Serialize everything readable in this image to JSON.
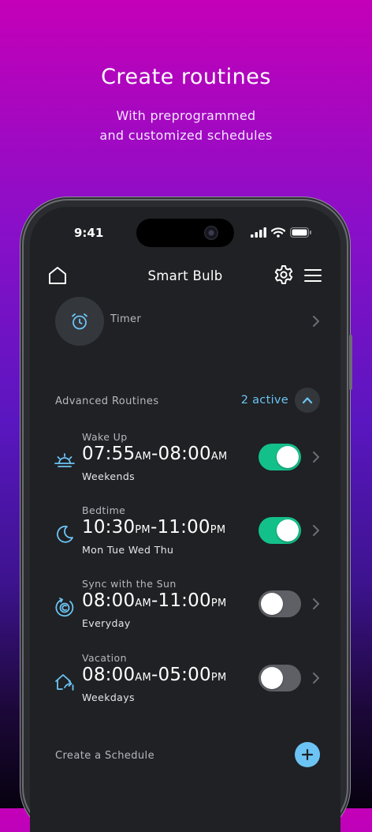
{
  "promo": {
    "headline": "Create routines",
    "sub_line1": "With preprogrammed",
    "sub_line2": "and customized schedules"
  },
  "status_bar": {
    "time": "9:41"
  },
  "header": {
    "title": "Smart Bulb"
  },
  "timer": {
    "label": "Timer",
    "icon": "alarm-clock-icon"
  },
  "routines_section": {
    "title": "Advanced Routines",
    "active_count": "2 active"
  },
  "routines": [
    {
      "name": "Wake Up",
      "start": "07:55",
      "start_period": "AM",
      "end": "08:00",
      "end_period": "AM",
      "days": "Weekends",
      "enabled": true,
      "icon": "sunrise-icon"
    },
    {
      "name": "Bedtime",
      "start": "10:30",
      "start_period": "PM",
      "end": "11:00",
      "end_period": "PM",
      "days": "Mon Tue Wed Thu",
      "enabled": true,
      "icon": "moon-icon"
    },
    {
      "name": "Sync with the Sun",
      "start": "08:00",
      "start_period": "AM",
      "end": "11:00",
      "end_period": "PM",
      "days": "Everyday",
      "enabled": false,
      "icon": "sun-sync-icon"
    },
    {
      "name": "Vacation",
      "start": "08:00",
      "start_period": "AM",
      "end": "05:00",
      "end_period": "PM",
      "days": "Weekdays",
      "enabled": false,
      "icon": "home-away-icon"
    }
  ],
  "create_schedule": {
    "label": "Create a Schedule"
  },
  "colors": {
    "accent_blue": "#6cc4f4",
    "toggle_on": "#14c08a",
    "toggle_off": "#5e6066",
    "screen_bg": "#1f2124"
  }
}
